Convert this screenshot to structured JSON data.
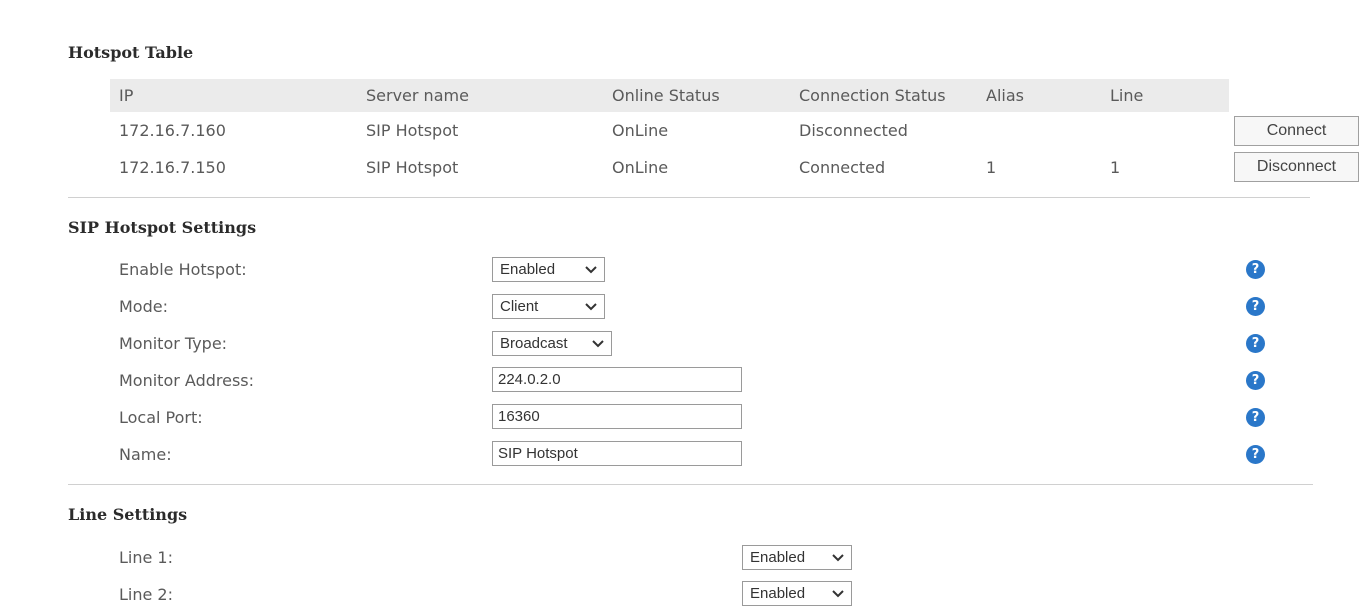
{
  "hotspot_table": {
    "title": "Hotspot Table",
    "columns": [
      "IP",
      "Server name",
      "Online Status",
      "Connection Status",
      "Alias",
      "Line"
    ],
    "rows": [
      {
        "ip": "172.16.7.160",
        "server_name": "SIP Hotspot",
        "online_status": "OnLine",
        "connection_status": "Disconnected",
        "alias": "",
        "line": "",
        "action_label": "Connect"
      },
      {
        "ip": "172.16.7.150",
        "server_name": "SIP Hotspot",
        "online_status": "OnLine",
        "connection_status": "Connected",
        "alias": "1",
        "line": "1",
        "action_label": "Disconnect"
      }
    ]
  },
  "sip_hotspot_settings": {
    "title": "SIP Hotspot Settings",
    "enable_hotspot": {
      "label": "Enable Hotspot:",
      "value": "Enabled"
    },
    "mode": {
      "label": "Mode:",
      "value": "Client"
    },
    "monitor_type": {
      "label": "Monitor Type:",
      "value": "Broadcast"
    },
    "monitor_address": {
      "label": "Monitor Address:",
      "value": "224.0.2.0"
    },
    "local_port": {
      "label": "Local Port:",
      "value": "16360"
    },
    "name": {
      "label": "Name:",
      "value": "SIP Hotspot"
    },
    "help_glyph": "?"
  },
  "line_settings": {
    "title": "Line Settings",
    "line1": {
      "label": "Line 1:",
      "value": "Enabled"
    },
    "line2": {
      "label": "Line 2:",
      "value": "Enabled"
    }
  },
  "colors": {
    "header_bg": "#ebebeb",
    "help_icon": "#2a77c9",
    "divider": "#d0d0d0"
  },
  "icons": {
    "dropdown": "chevron-down-icon",
    "help": "help-icon"
  }
}
